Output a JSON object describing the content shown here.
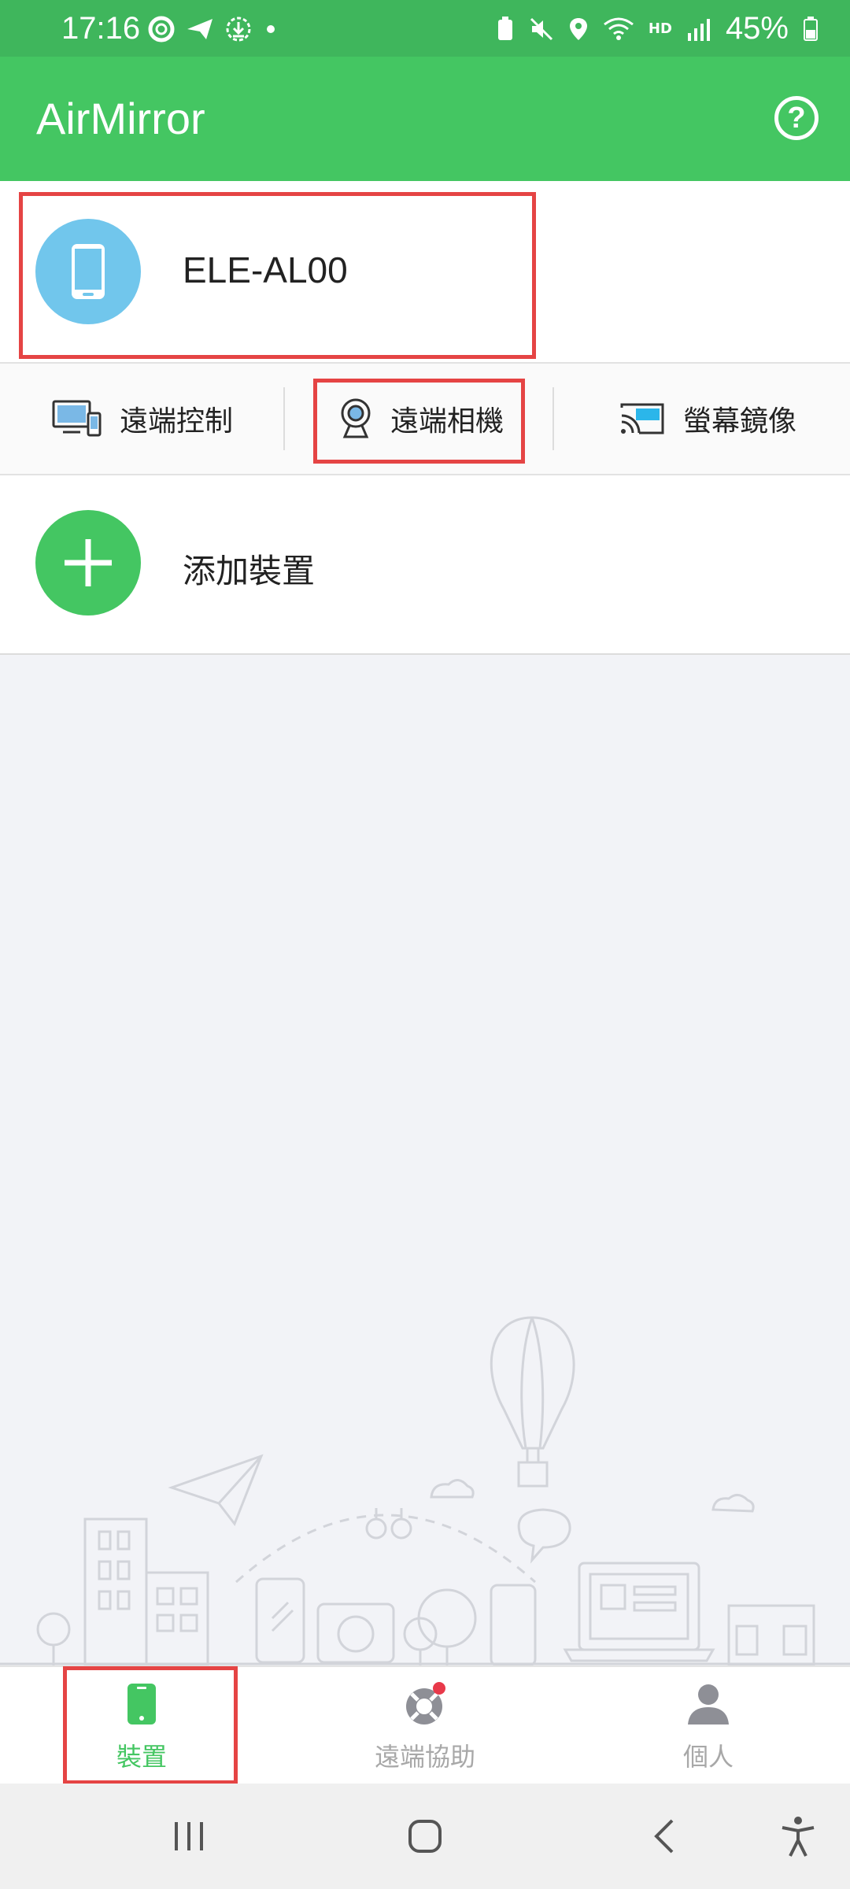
{
  "status_bar": {
    "time": "17:16",
    "network": "HD",
    "battery": "45%"
  },
  "app_bar": {
    "title": "AirMirror",
    "help_icon": "help-circle-icon"
  },
  "device": {
    "name": "ELE-AL00",
    "icon": "phone-icon"
  },
  "actions": [
    {
      "label": "遠端控制",
      "icon": "remote-control-icon"
    },
    {
      "label": "遠端相機",
      "icon": "webcam-icon"
    },
    {
      "label": "螢幕鏡像",
      "icon": "screen-mirror-icon"
    }
  ],
  "add_device": {
    "label": "添加裝置",
    "icon": "plus-icon"
  },
  "bottom_nav": [
    {
      "label": "裝置",
      "icon": "phone-icon",
      "active": true
    },
    {
      "label": "遠端協助",
      "icon": "lifebuoy-icon",
      "active": false
    },
    {
      "label": "個人",
      "icon": "person-icon",
      "active": false
    }
  ],
  "colors": {
    "brand": "#44c662",
    "status_bar": "#3fb65c",
    "avatar": "#71c6ec",
    "highlight": "#e54444"
  }
}
